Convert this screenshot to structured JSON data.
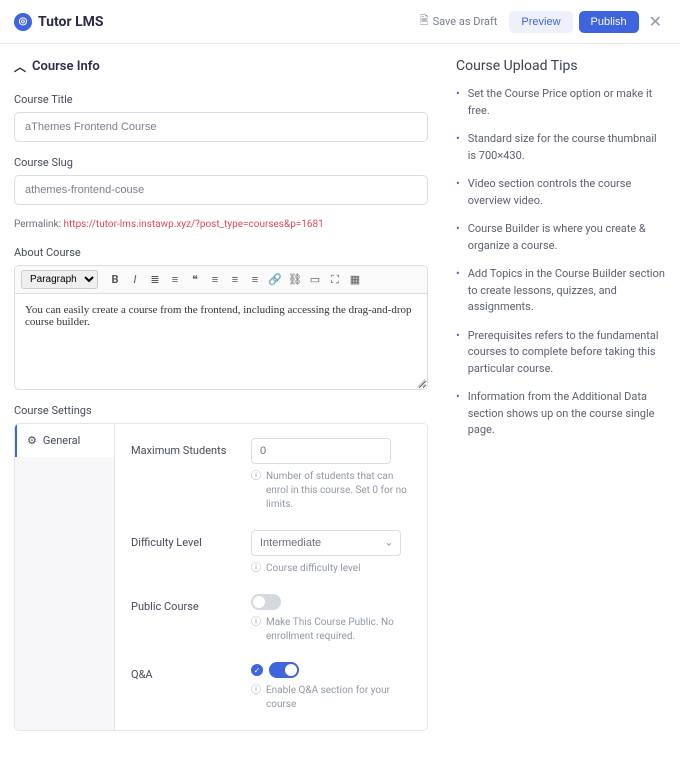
{
  "brand": "Tutor LMS",
  "topbar": {
    "save_draft": "Save as Draft",
    "preview": "Preview",
    "publish": "Publish"
  },
  "section": {
    "course_info": "Course Info"
  },
  "fields": {
    "title_label": "Course Title",
    "title_value": "aThemes Frontend Course",
    "slug_label": "Course Slug",
    "slug_value": "athemes-frontend-couse",
    "permalink_label": "Permalink:",
    "permalink_url": "https://tutor-lms.instawp.xyz/?post_type=courses&p=1681",
    "about_label": "About Course",
    "format_select": "Paragraph",
    "about_body": "You can easily create a course from the frontend, including accessing the drag-and-drop course builder."
  },
  "settings": {
    "heading": "Course Settings",
    "tab_general": "General",
    "max_students": {
      "label": "Maximum Students",
      "value": "0",
      "hint": "Number of students that can enrol in this course. Set 0 for no limits."
    },
    "difficulty": {
      "label": "Difficulty Level",
      "value": "Intermediate",
      "hint": "Course difficulty level"
    },
    "public": {
      "label": "Public Course",
      "hint": "Make This Course Public. No enrollment required.",
      "on": false
    },
    "qa": {
      "label": "Q&A",
      "hint": "Enable Q&A section for your course",
      "on": true
    }
  },
  "tips": {
    "heading": "Course Upload Tips",
    "items": [
      "Set the Course Price option or make it free.",
      "Standard size for the course thumbnail is 700×430.",
      "Video section controls the course overview video.",
      "Course Builder is where you create & organize a course.",
      "Add Topics in the Course Builder section to create lessons, quizzes, and assignments.",
      "Prerequisites refers to the fundamental courses to complete before taking this particular course.",
      "Information from the Additional Data section shows up on the course single page."
    ]
  }
}
